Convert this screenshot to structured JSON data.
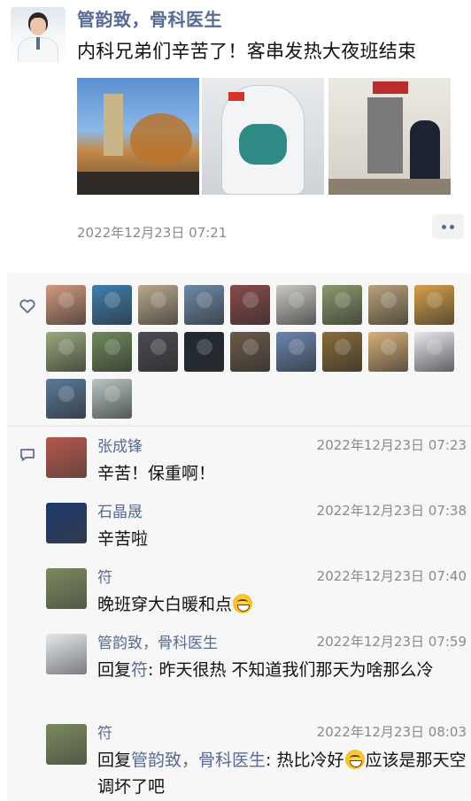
{
  "post": {
    "author": "管韵致，骨科医生",
    "text": "内科兄弟们辛苦了！客串发热大夜班结束",
    "photos": [
      {
        "icon": "street-trees-photo"
      },
      {
        "icon": "protective-suit-selfie-photo"
      },
      {
        "icon": "fever-clinic-door-photo"
      }
    ],
    "timestamp": "2022年12月23日 07:21",
    "more_icon": "more-dots-icon"
  },
  "likes": {
    "icon": "heart-icon",
    "avatars": [
      {
        "icon": "sunset-avatar",
        "bg": "#d39a7e"
      },
      {
        "icon": "silhouette-avatar",
        "bg": "#3f7fb0"
      },
      {
        "icon": "cat-avatar",
        "bg": "#b9a98e"
      },
      {
        "icon": "child-avatar",
        "bg": "#6d8aa8"
      },
      {
        "icon": "anime-avatar",
        "bg": "#8a4a4a"
      },
      {
        "icon": "figure-avatar",
        "bg": "#c9c8c4"
      },
      {
        "icon": "landscape-avatar",
        "bg": "#8a9a6a"
      },
      {
        "icon": "building-avatar",
        "bg": "#b8a27a"
      },
      {
        "icon": "cat-face-avatar",
        "bg": "#d6a14a"
      },
      {
        "icon": "woman-avatar",
        "bg": "#9aa87c"
      },
      {
        "icon": "path-avatar",
        "bg": "#6f8a5a"
      },
      {
        "icon": "couple-avatar",
        "bg": "#4a4a52"
      },
      {
        "icon": "pill-avatar",
        "bg": "#1f2933"
      },
      {
        "icon": "owl-avatar",
        "bg": "#6a5a48"
      },
      {
        "icon": "mountain-avatar",
        "bg": "#6a86b0"
      },
      {
        "icon": "field-avatar",
        "bg": "#8a6a3a"
      },
      {
        "icon": "dog-avatar",
        "bg": "#d8b07a"
      },
      {
        "icon": "masked-man-avatar",
        "bg": "#e6e9ee"
      },
      {
        "icon": "globe-avatar",
        "bg": "#5a7a9a"
      },
      {
        "icon": "plant-avatar",
        "bg": "#b8c6c4"
      }
    ]
  },
  "comments": {
    "icon": "comment-icon",
    "items": [
      {
        "name": "张成锋",
        "time": "2022年12月23日 07:23",
        "text": "辛苦！保重啊！",
        "avatar_bg": "#b5564a",
        "avatar_icon": "blossom-avatar"
      },
      {
        "name": "石晶晟",
        "time": "2022年12月23日 07:38",
        "text": "辛苦啦",
        "avatar_bg": "#1e3a6e",
        "avatar_icon": "university-seal-avatar"
      },
      {
        "name": "符",
        "time": "2022年12月23日 07:40",
        "text": "晚班穿大白暖和点",
        "emoji": "grin-emoji",
        "avatar_bg": "#7a8a5e",
        "avatar_icon": "nature-avatar"
      },
      {
        "name": "管韵致，骨科医生",
        "time": "2022年12月23日 07:59",
        "reply_prefix": "回复",
        "reply_to": "符",
        "reply_sep": ": ",
        "text": "昨天很热 不知道我们那天为啥那么冷",
        "avatar_bg": "#e4e9ef",
        "avatar_icon": "doctor-avatar"
      },
      {
        "name": "符",
        "time": "2022年12月23日 08:03",
        "reply_prefix": "回复",
        "reply_to": "管韵致，骨科医生",
        "reply_sep": ": ",
        "text_before": "热比冷好",
        "emoji": "laugh-emoji",
        "text_after": "应该是那天空调坏了吧",
        "avatar_bg": "#7a8a5e",
        "avatar_icon": "nature-avatar"
      }
    ]
  },
  "colors": {
    "link": "#576b95",
    "muted": "#8a8a8a",
    "panel": "#f7f7f7"
  }
}
